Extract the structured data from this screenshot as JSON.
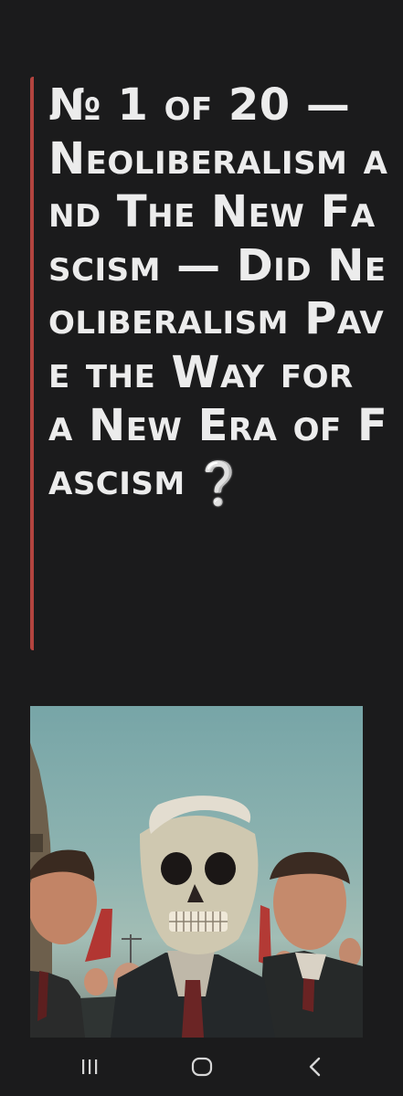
{
  "post": {
    "title": "№ 1 of 20 — Neoliberalism and The New Fascism — Did Neoliberalism Pave the Way for a New Era of Fascism",
    "title_icon": "question-mark-emoji",
    "accent_color": "#b3443f"
  },
  "image": {
    "subject": "skull-faced figure in suit among crowd of men"
  },
  "nav": {
    "recents_icon": "recents-icon",
    "home_icon": "home-icon",
    "back_icon": "back-icon"
  }
}
